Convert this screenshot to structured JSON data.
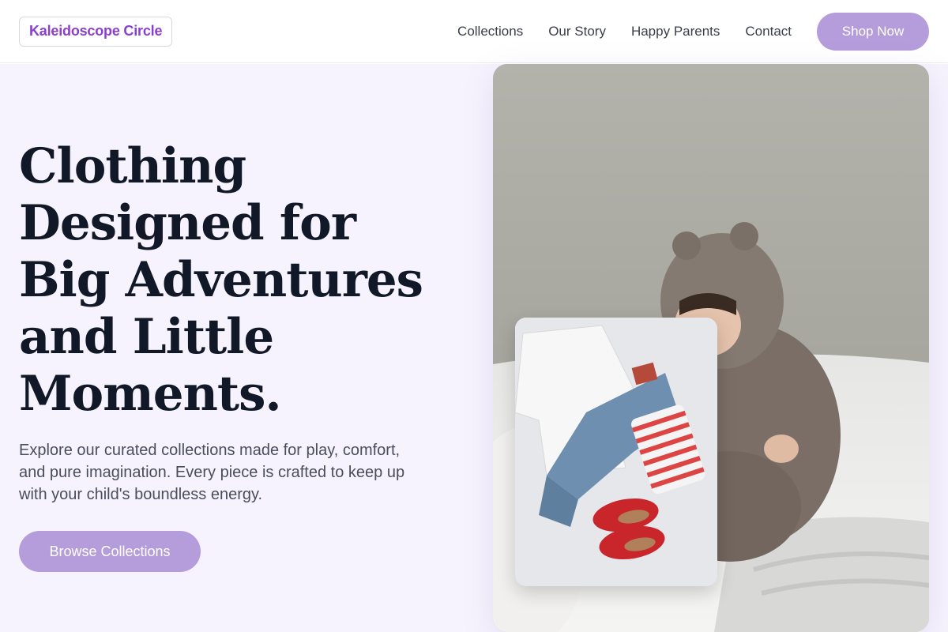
{
  "header": {
    "logo": "Kaleidoscope Circle",
    "nav": [
      "Collections",
      "Our Story",
      "Happy Parents",
      "Contact"
    ],
    "cta": "Shop Now"
  },
  "hero": {
    "headline_lines": [
      "Clothing",
      "Designed for",
      "Big Adventures",
      "and Little",
      "Moments."
    ],
    "subtext": "Explore our curated collections made for play, comfort, and pure imagination. Every piece is crafted to keep up with your child's boundless energy.",
    "cta": "Browse Collections"
  },
  "colors": {
    "brand": "#8a3fd1",
    "button": "#b59ddc",
    "hero_bg": "#f6f3fe",
    "headline": "#111827"
  }
}
